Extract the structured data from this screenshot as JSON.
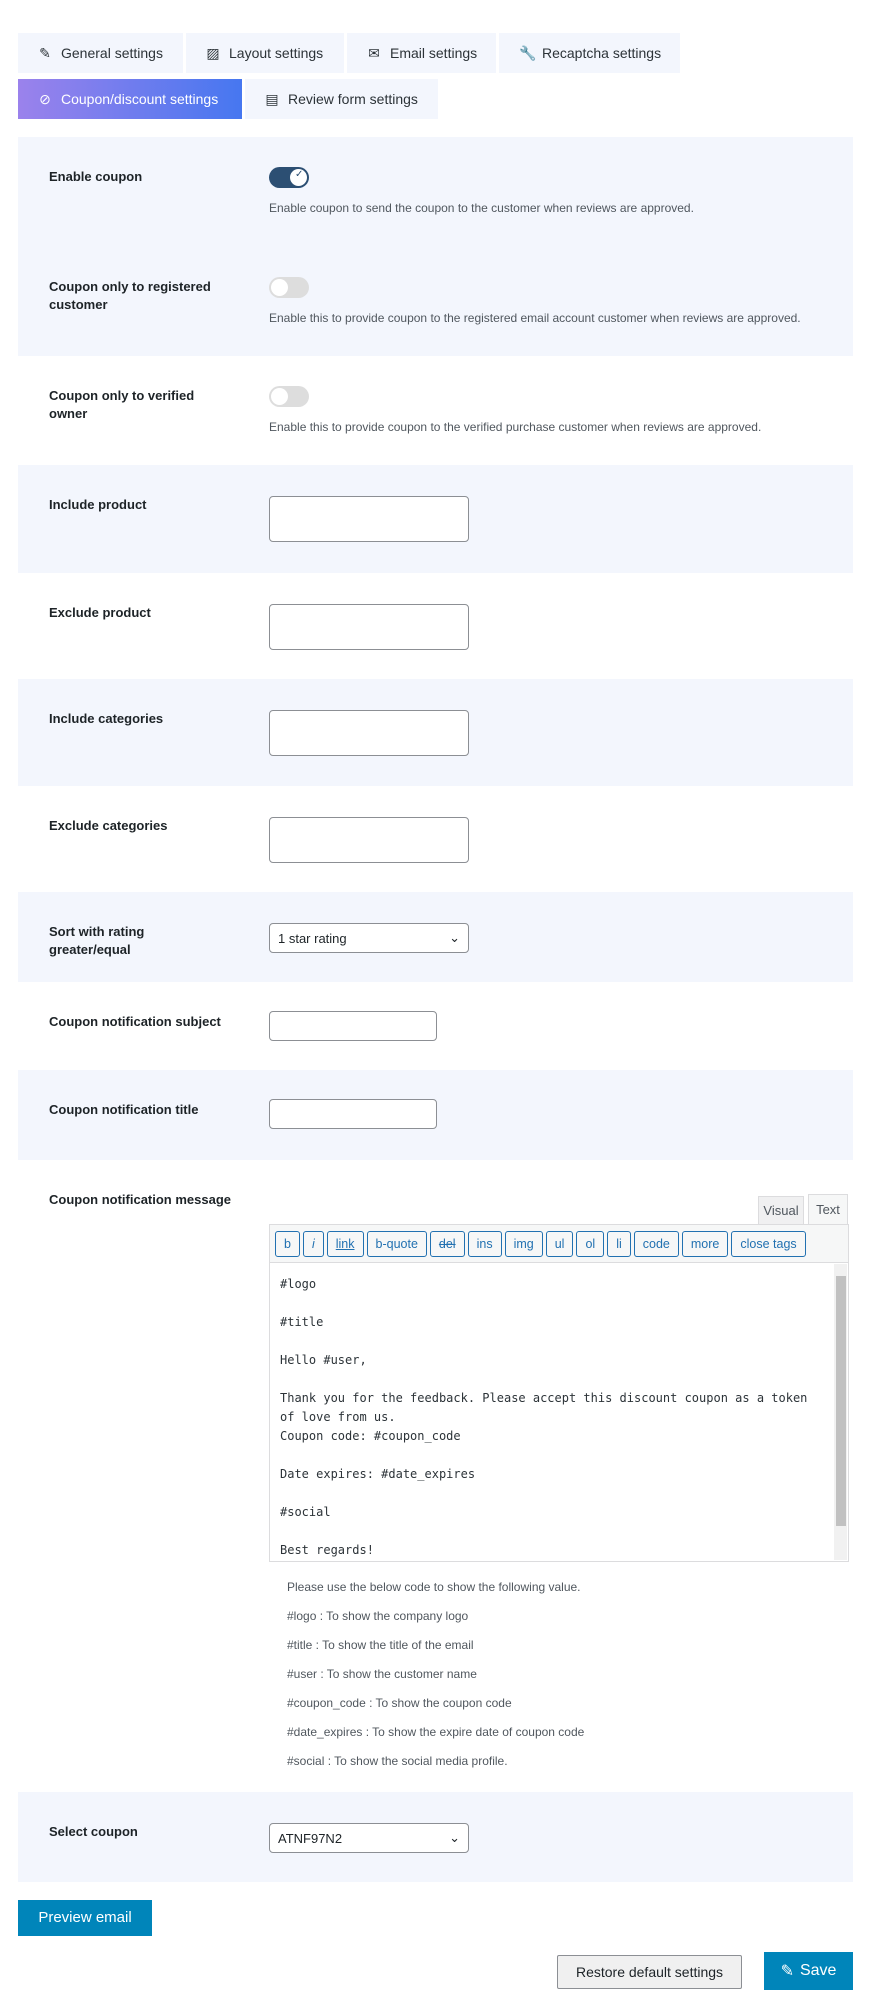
{
  "tabs": [
    {
      "label": "General settings",
      "icon": "edit-icon"
    },
    {
      "label": "Layout settings",
      "icon": "image-icon"
    },
    {
      "label": "Email settings",
      "icon": "envelope-icon"
    },
    {
      "label": "Recaptcha settings",
      "icon": "wrench-icon"
    },
    {
      "label": "Coupon/discount settings",
      "icon": "percent-icon",
      "active": true
    },
    {
      "label": "Review form settings",
      "icon": "document-icon"
    }
  ],
  "fields": {
    "enable_coupon": {
      "label": "Enable coupon",
      "on": true,
      "desc": "Enable coupon to send the coupon to the customer when reviews are approved."
    },
    "registered": {
      "label": "Coupon only to registered customer",
      "on": false,
      "desc": "Enable this to provide coupon to the registered email account customer when reviews are approved."
    },
    "verified": {
      "label": "Coupon only to verified owner",
      "on": false,
      "desc": "Enable this to provide coupon to the verified purchase customer when reviews are approved."
    },
    "include_product": {
      "label": "Include product",
      "value": ""
    },
    "exclude_product": {
      "label": "Exclude product",
      "value": ""
    },
    "include_categories": {
      "label": "Include categories",
      "value": ""
    },
    "exclude_categories": {
      "label": "Exclude categories",
      "value": ""
    },
    "sort": {
      "label": "Sort with rating greater/equal",
      "value": "1 star rating"
    },
    "subject": {
      "label": "Coupon notification subject",
      "value": ""
    },
    "title": {
      "label": "Coupon notification title",
      "value": ""
    },
    "message": {
      "label": "Coupon notification message",
      "tab_visual": "Visual",
      "tab_text": "Text",
      "toolbar": [
        "b",
        "i",
        "link",
        "b-quote",
        "del",
        "ins",
        "img",
        "ul",
        "ol",
        "li",
        "code",
        "more",
        "close tags"
      ],
      "content": "#logo\n\n#title\n\nHello #user,\n\nThank you for the feedback. Please accept this discount coupon as a token of love from us.\nCoupon code: #coupon_code\n\nDate expires: #date_expires\n\n#social\n\nBest regards!",
      "help": [
        "Please use the below code to show the following value.",
        "#logo : To show the company logo",
        "#title : To show the title of the email",
        "#user : To show the customer name",
        "#coupon_code : To show the coupon code",
        "#date_expires : To show the expire date of coupon code",
        "#social : To show the social media profile."
      ]
    },
    "select_coupon": {
      "label": "Select coupon",
      "value": "ATNF97N2"
    }
  },
  "buttons": {
    "preview": "Preview email",
    "restore": "Restore default settings",
    "save": "Save"
  },
  "colors": {
    "primary": "#0085ba",
    "toggle_on": "#2c4f73",
    "section_bg": "#f3f6fd"
  }
}
